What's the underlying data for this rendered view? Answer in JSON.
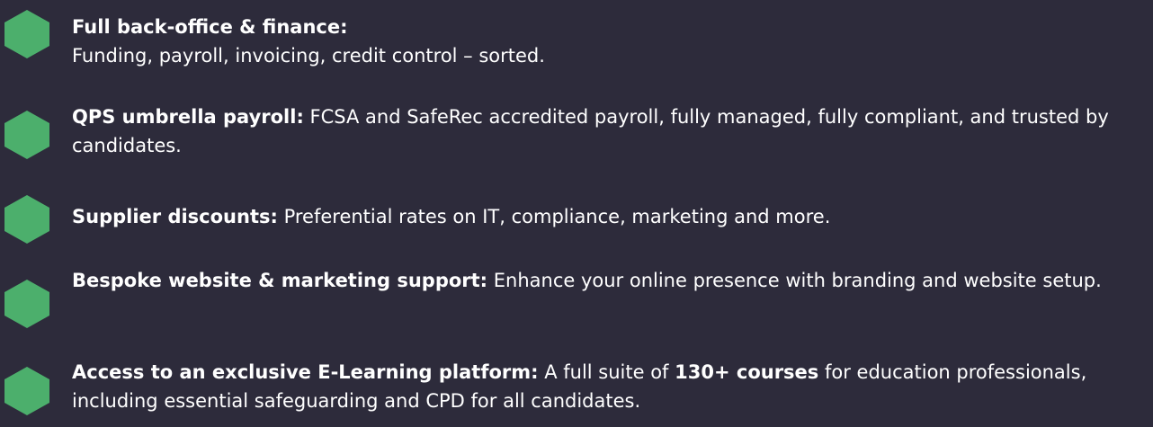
{
  "colors": {
    "background": "#2d2b3b",
    "accent": "#4caf6c",
    "text": "#ffffff"
  },
  "benefits": [
    {
      "title": "Full back-office & finance:",
      "body": "Funding, payroll, invoicing, credit control – sorted."
    },
    {
      "title": "QPS umbrella payroll:",
      "body": " FCSA and SafeRec accredited payroll, fully managed, fully compliant, and trusted by candidates."
    },
    {
      "title": "Supplier discounts:",
      "body": " Preferential rates on IT, compliance, marketing and more."
    },
    {
      "title": "Bespoke website & marketing support:",
      "body": " Enhance your online presence with branding and website setup."
    },
    {
      "title": "Access to an exclusive E-Learning platform:",
      "body_prefix": " A full suite of ",
      "body_strong": "130+ courses",
      "body_suffix": " for education professionals, including essential safeguarding and CPD for all candidates."
    }
  ]
}
